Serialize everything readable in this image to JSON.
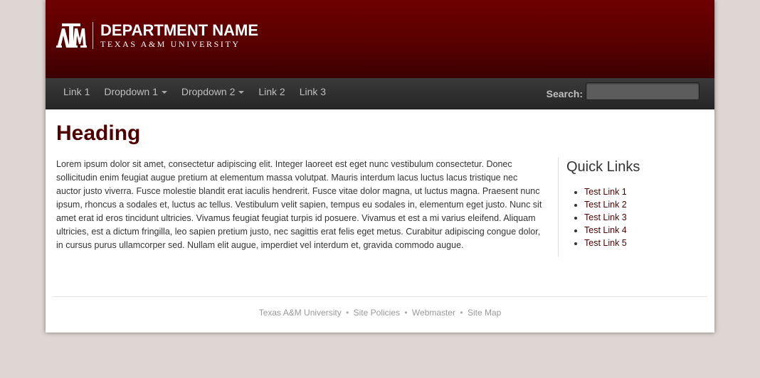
{
  "header": {
    "logo_text": "ATM",
    "department_name": "DEPARTMENT NAME",
    "university_name": "TEXAS A&M UNIVERSITY",
    "background_color": "#500000"
  },
  "nav": {
    "items": [
      {
        "label": "Link 1",
        "dropdown": false
      },
      {
        "label": "Dropdown 1",
        "dropdown": true
      },
      {
        "label": "Dropdown 2",
        "dropdown": true
      },
      {
        "label": "Link 2",
        "dropdown": false
      },
      {
        "label": "Link 3",
        "dropdown": false
      }
    ],
    "search_label": "Search:",
    "search_value": "",
    "search_placeholder": ""
  },
  "main": {
    "heading": "Heading",
    "body": "Lorem ipsum dolor sit amet, consectetur adipiscing elit. Integer laoreet est eget nunc vestibulum consectetur. Donec sollicitudin enim feugiat augue pretium at elementum massa volutpat. Mauris interdum lacus luctus lacus tristique nec auctor justo viverra. Fusce molestie blandit erat iaculis hendrerit. Fusce vitae dolor magna, ut luctus magna. Praesent nunc ipsum, rhoncus a sodales et, luctus ac tellus. Vestibulum velit sapien, tempus eu sodales in, elementum eget justo. Nunc sit amet erat id eros tincidunt ultricies. Vivamus feugiat feugiat turpis id posuere. Vivamus et est a mi varius eleifend. Aliquam ultricies, est a dictum fringilla, leo sapien pretium justo, nec sagittis erat felis eget metus. Curabitur adipiscing congue dolor, in cursus purus ullamcorper sed. Nullam elit augue, imperdiet vel interdum et, gravida commodo augue."
  },
  "sidebar": {
    "title": "Quick Links",
    "links": [
      "Test Link 1",
      "Test Link 2",
      "Test Link 3",
      "Test Link 4",
      "Test Link 5"
    ]
  },
  "footer": {
    "links": [
      "Texas A&M University",
      "Site Policies",
      "Webmaster",
      "Site Map"
    ],
    "separator": "•"
  },
  "colors": {
    "maroon": "#500000",
    "page_background": "#ddd6d2",
    "navbar": "#2d2d2d"
  }
}
